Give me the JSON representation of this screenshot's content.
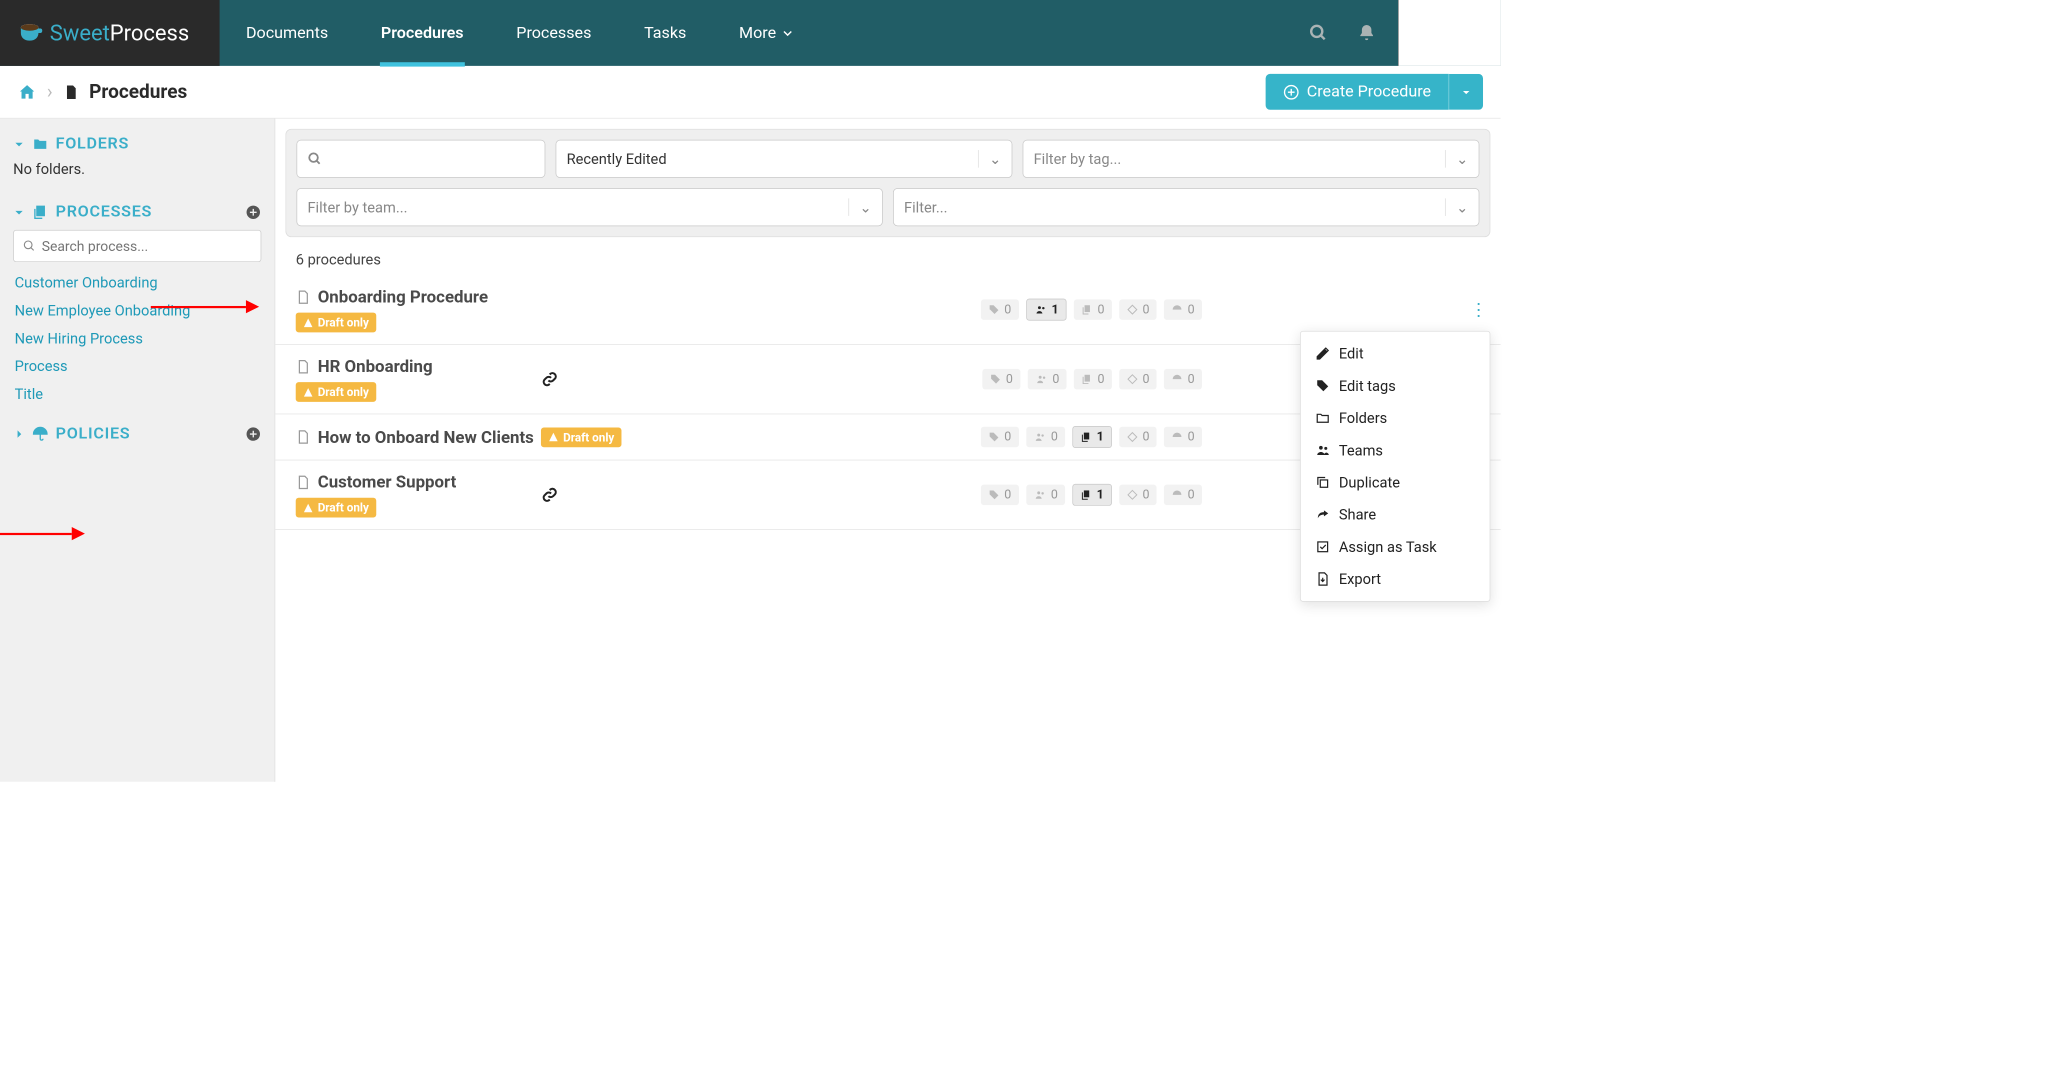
{
  "brand": {
    "a": "Sweet",
    "b": "Process"
  },
  "nav": {
    "documents": "Documents",
    "procedures": "Procedures",
    "processes": "Processes",
    "tasks": "Tasks",
    "more": "More"
  },
  "breadcrumb": {
    "title": "Procedures",
    "sep": "›"
  },
  "create": {
    "label": "Create Procedure"
  },
  "sidebar": {
    "folders": {
      "title": "FOLDERS",
      "empty": "No folders."
    },
    "processes": {
      "title": "PROCESSES",
      "search_ph": "Search process...",
      "items": [
        "Customer Onboarding",
        "New Employee Onboarding",
        "New Hiring Process",
        "Process",
        "Title"
      ]
    },
    "policies": {
      "title": "POLICIES"
    }
  },
  "filters": {
    "sort": "Recently Edited",
    "tag_ph": "Filter by tag...",
    "team_ph": "Filter by team...",
    "filter_ph": "Filter..."
  },
  "count": "6 procedures",
  "draft": "Draft only",
  "rows": [
    {
      "title": "Onboarding Procedure",
      "link": false,
      "tag": "0",
      "people": "1",
      "people_hl": true,
      "copies": "0",
      "diamond": "0",
      "umb": "0"
    },
    {
      "title": "HR Onboarding",
      "link": true,
      "tag": "0",
      "people": "0",
      "people_hl": false,
      "copies": "0",
      "diamond": "0",
      "umb": "0"
    },
    {
      "title": "How to Onboard New Clients",
      "link": false,
      "tag": "0",
      "people": "0",
      "people_hl": false,
      "copies": "1",
      "copies_hl": true,
      "diamond": "0",
      "umb": "0"
    },
    {
      "title": "Customer Support",
      "link": true,
      "tag": "0",
      "people": "0",
      "people_hl": false,
      "copies": "1",
      "copies_hl": true,
      "diamond": "0",
      "umb": "0"
    }
  ],
  "menu": {
    "edit": "Edit",
    "tags": "Edit tags",
    "folders": "Folders",
    "teams": "Teams",
    "dup": "Duplicate",
    "share": "Share",
    "assign": "Assign as Task",
    "export": "Export"
  }
}
